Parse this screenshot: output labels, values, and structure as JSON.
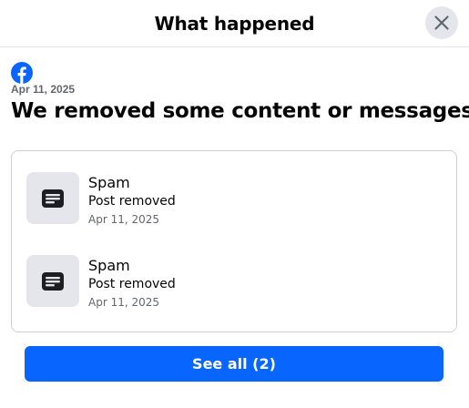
{
  "header": {
    "title": "What happened",
    "close_icon": "close-icon"
  },
  "brand": {
    "logo_icon": "facebook-logo-icon",
    "color": "#0866ff"
  },
  "summary": {
    "date": "Apr 11, 2025",
    "title": "We removed some content or messages"
  },
  "items": [
    {
      "icon": "post-icon",
      "title": "Spam",
      "status": "Post removed",
      "date": "Apr 11, 2025"
    },
    {
      "icon": "post-icon",
      "title": "Spam",
      "status": "Post removed",
      "date": "Apr 11, 2025"
    }
  ],
  "footer": {
    "see_all_label": "See all (2)",
    "button_color": "#0866ff"
  }
}
